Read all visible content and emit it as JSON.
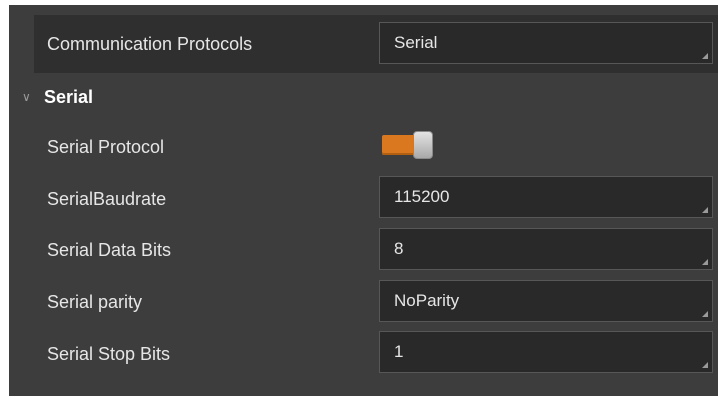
{
  "top": {
    "label": "Communication Protocols",
    "value": "Serial"
  },
  "section": {
    "title": "Serial",
    "expanded": true,
    "icon": "chevron-down-icon"
  },
  "serial_protocol": {
    "label": "Serial Protocol",
    "enabled": true,
    "accent_color": "#d9781f"
  },
  "fields": {
    "baudrate": {
      "label": "SerialBaudrate",
      "value": "115200"
    },
    "data_bits": {
      "label": "Serial Data Bits",
      "value": "8"
    },
    "parity": {
      "label": "Serial parity",
      "value": "NoParity"
    },
    "stop_bits": {
      "label": "Serial Stop Bits",
      "value": "1"
    }
  }
}
